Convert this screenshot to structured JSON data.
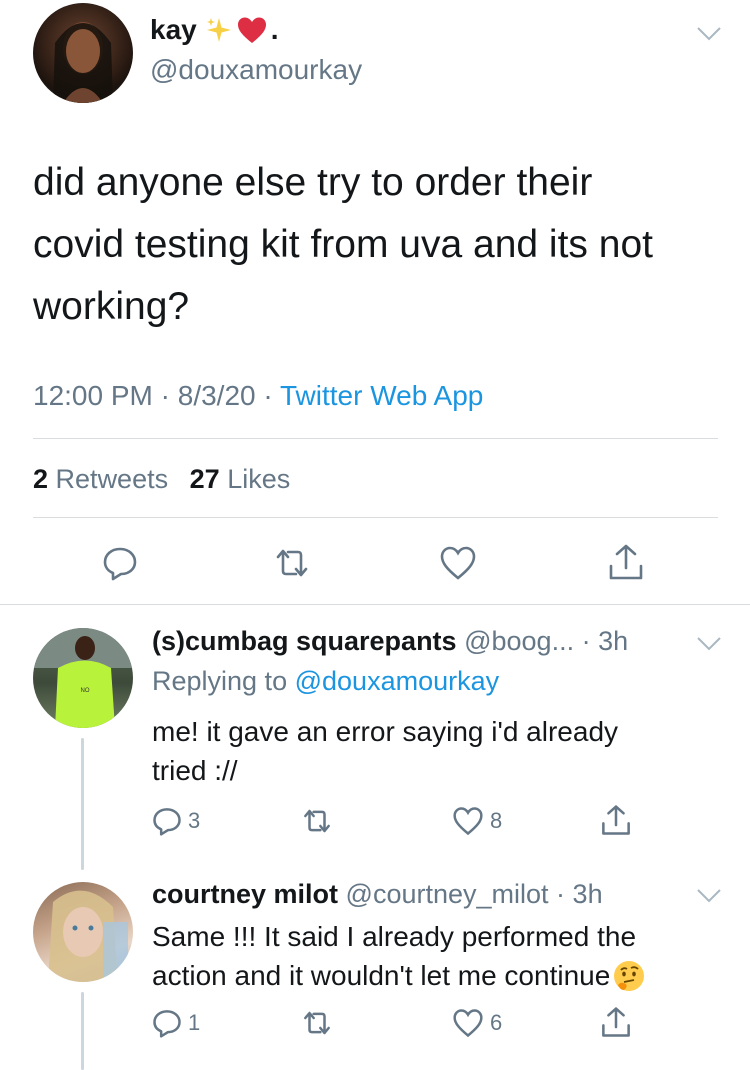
{
  "main_tweet": {
    "display_name": "kay",
    "name_suffix": ".",
    "handle": "@douxamourkay",
    "text_lines": [
      "did anyone else try to order their",
      "covid testing kit from uva and its not",
      "working?"
    ],
    "time": "12:00 PM",
    "date": "8/3/20",
    "source": "Twitter Web App",
    "retweets_count": "2",
    "retweets_label": "Retweets",
    "likes_count": "27",
    "likes_label": "Likes"
  },
  "replies": [
    {
      "display_name": "(s)cumbag squarepants",
      "handle": "@boog...",
      "age": "3h",
      "replying_prefix": "Replying to",
      "replying_to": "@douxamourkay",
      "text_lines": [
        "me! it gave an error saying i'd already",
        "tried  ://"
      ],
      "reply_count": "3",
      "like_count": "8"
    },
    {
      "display_name": "courtney milot",
      "handle": "@courtney_milot",
      "age": "3h",
      "text_lines": [
        "Same !!! It said I already performed the",
        "action and it wouldn't let me continue"
      ],
      "reply_count": "1",
      "like_count": "6"
    }
  ],
  "colors": {
    "text": "#14171a",
    "muted": "#657786",
    "link": "#1b95e0",
    "divider": "#d9dde0"
  },
  "icons": [
    "chevron-down-icon",
    "sparkles-icon",
    "heart-emoji-icon",
    "reply-icon",
    "retweet-icon",
    "like-icon",
    "share-icon",
    "thinking-emoji-icon"
  ]
}
